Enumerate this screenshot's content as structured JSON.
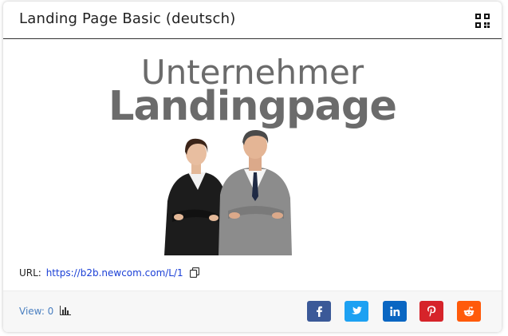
{
  "card": {
    "title": "Landing Page Basic (deutsch)",
    "hero": {
      "line1": "Unternehmer",
      "line2": "Landingpage"
    },
    "url_label": "URL:",
    "url": "https://b2b.newcom.com/L/1",
    "views": "View: 0"
  },
  "icons": {
    "qr": "qr-code-icon",
    "copy": "copy-icon",
    "stats": "bar-chart-icon",
    "social": [
      "facebook-icon",
      "twitter-icon",
      "linkedin-icon",
      "pinterest-icon",
      "reddit-icon"
    ]
  },
  "colors": {
    "facebook": "#3b5998",
    "twitter": "#1da1f2",
    "linkedin": "#0a66c2",
    "pinterest": "#d6242a",
    "reddit": "#ff5a0a",
    "link": "#1a3fd6",
    "view": "#4a7fc0"
  }
}
